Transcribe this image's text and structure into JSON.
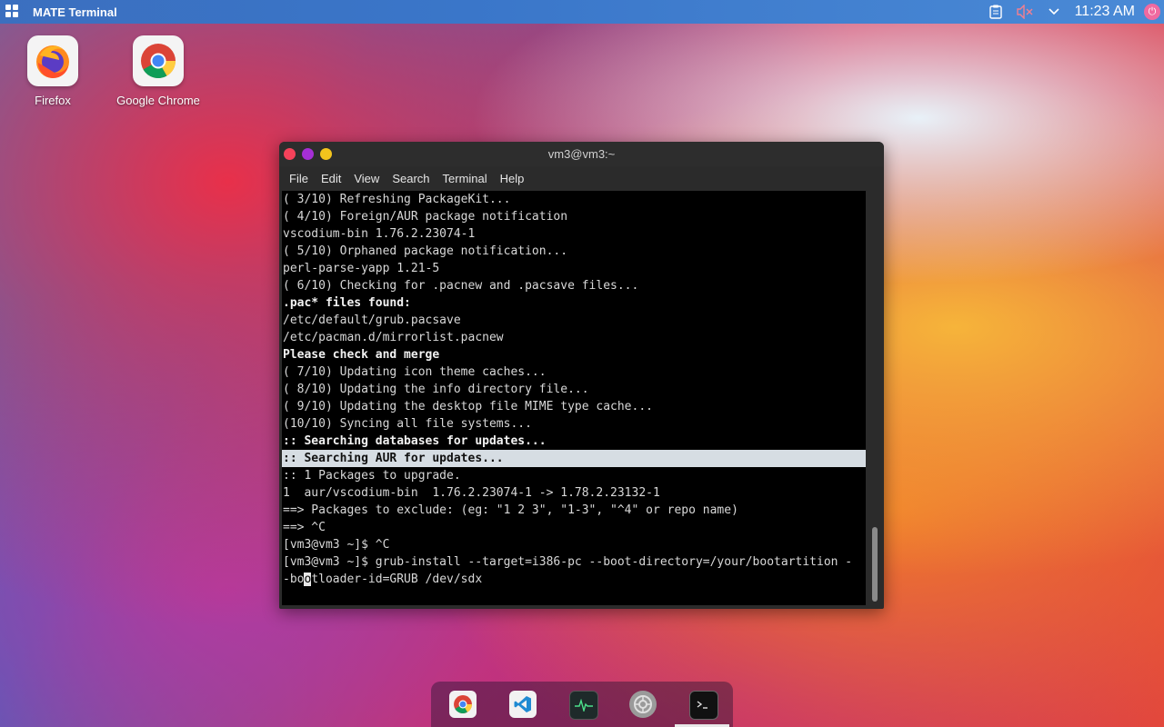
{
  "topbar": {
    "app_title": "MATE Terminal",
    "clock": "11:23 AM",
    "icons": [
      "clipboard-icon",
      "volume-muted-icon",
      "chevron-down-icon",
      "power-icon"
    ]
  },
  "desktop": {
    "icons": [
      {
        "label": "Firefox",
        "icon": "firefox-icon"
      },
      {
        "label": "Google Chrome",
        "icon": "chrome-icon"
      }
    ]
  },
  "window": {
    "title": "vm3@vm3:~",
    "menu": [
      "File",
      "Edit",
      "View",
      "Search",
      "Terminal",
      "Help"
    ]
  },
  "terminal": {
    "lines": [
      {
        "text": "( 3/10) Refreshing PackageKit...",
        "style": "normal"
      },
      {
        "text": "( 4/10) Foreign/AUR package notification",
        "style": "normal"
      },
      {
        "text": "vscodium-bin 1.76.2.23074-1",
        "style": "normal"
      },
      {
        "text": "( 5/10) Orphaned package notification...",
        "style": "normal"
      },
      {
        "text": "perl-parse-yapp 1.21-5",
        "style": "normal"
      },
      {
        "text": "( 6/10) Checking for .pacnew and .pacsave files...",
        "style": "normal"
      },
      {
        "text": ".pac* files found:",
        "style": "bold"
      },
      {
        "text": "/etc/default/grub.pacsave",
        "style": "normal"
      },
      {
        "text": "/etc/pacman.d/mirrorlist.pacnew",
        "style": "normal"
      },
      {
        "text": "Please check and merge",
        "style": "bold"
      },
      {
        "text": "( 7/10) Updating icon theme caches...",
        "style": "normal"
      },
      {
        "text": "( 8/10) Updating the info directory file...",
        "style": "normal"
      },
      {
        "text": "( 9/10) Updating the desktop file MIME type cache...",
        "style": "normal"
      },
      {
        "text": "(10/10) Syncing all file systems...",
        "style": "normal"
      },
      {
        "text": ":: Searching databases for updates...",
        "style": "bold"
      },
      {
        "text": ":: Searching AUR for updates...",
        "style": "highlight"
      },
      {
        "text": ":: 1 Packages to upgrade.",
        "style": "normal"
      },
      {
        "text": "1  aur/vscodium-bin  1.76.2.23074-1 -> 1.78.2.23132-1",
        "style": "normal"
      },
      {
        "text": "==> Packages to exclude: (eg: \"1 2 3\", \"1-3\", \"^4\" or repo name)",
        "style": "normal"
      },
      {
        "text": "==> ^C",
        "style": "normal"
      },
      {
        "text": "[vm3@vm3 ~]$ ^C",
        "style": "normal"
      },
      {
        "text": "[vm3@vm3 ~]$ grub-install --target=i386-pc --boot-directory=/your/bootartition -",
        "style": "normal"
      }
    ],
    "last_line": {
      "before": "-bo",
      "cursor": "o",
      "after": "tloader-id=GRUB /dev/sdx"
    }
  },
  "dock": {
    "items": [
      "chrome-icon",
      "vscode-icon",
      "system-monitor-icon",
      "settings-icon",
      "terminal-icon"
    ]
  }
}
